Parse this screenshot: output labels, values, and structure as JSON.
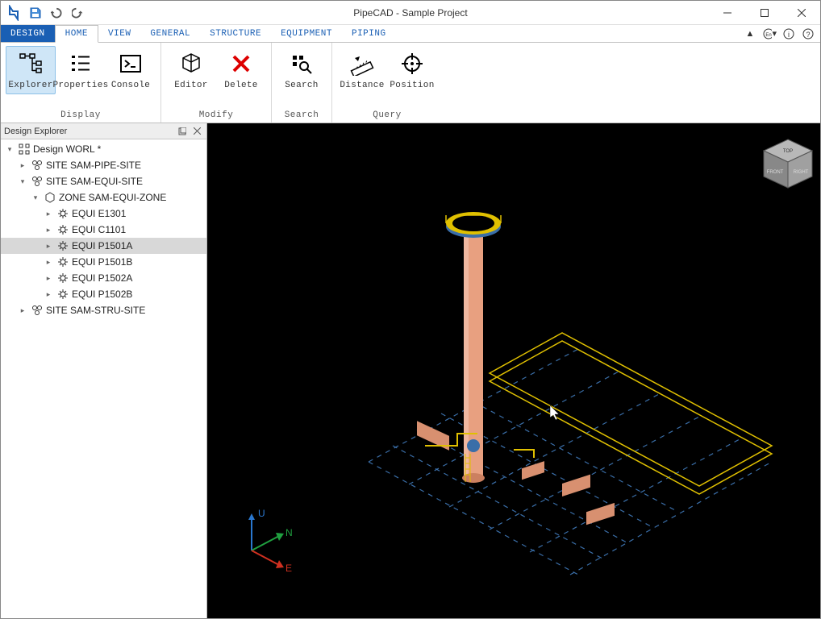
{
  "title": "PipeCAD - Sample Project",
  "tabs": {
    "design": "DESIGN",
    "home": "HOME",
    "view": "VIEW",
    "general": "GENERAL",
    "structure": "STRUCTURE",
    "equipment": "EQUIPMENT",
    "piping": "PIPING"
  },
  "ribbon": {
    "display": {
      "label": "Display",
      "explorer": "Explorer",
      "properties": "Properties",
      "console": "Console"
    },
    "modify": {
      "label": "Modify",
      "editor": "Editor",
      "delete": "Delete"
    },
    "search": {
      "label": "Search",
      "search": "Search"
    },
    "query": {
      "label": "Query",
      "distance": "Distance",
      "position": "Position"
    }
  },
  "panel": {
    "title": "Design Explorer"
  },
  "tree": {
    "root": "Design WORL *",
    "site1": "SITE SAM-PIPE-SITE",
    "site2": "SITE SAM-EQUI-SITE",
    "zone": "ZONE SAM-EQUI-ZONE",
    "equi": [
      "EQUI E1301",
      "EQUI C1101",
      "EQUI P1501A",
      "EQUI P1501B",
      "EQUI P1502A",
      "EQUI P1502B"
    ],
    "site3": "SITE SAM-STRU-SITE"
  },
  "axes": {
    "u": "U",
    "n": "N",
    "e": "E"
  }
}
